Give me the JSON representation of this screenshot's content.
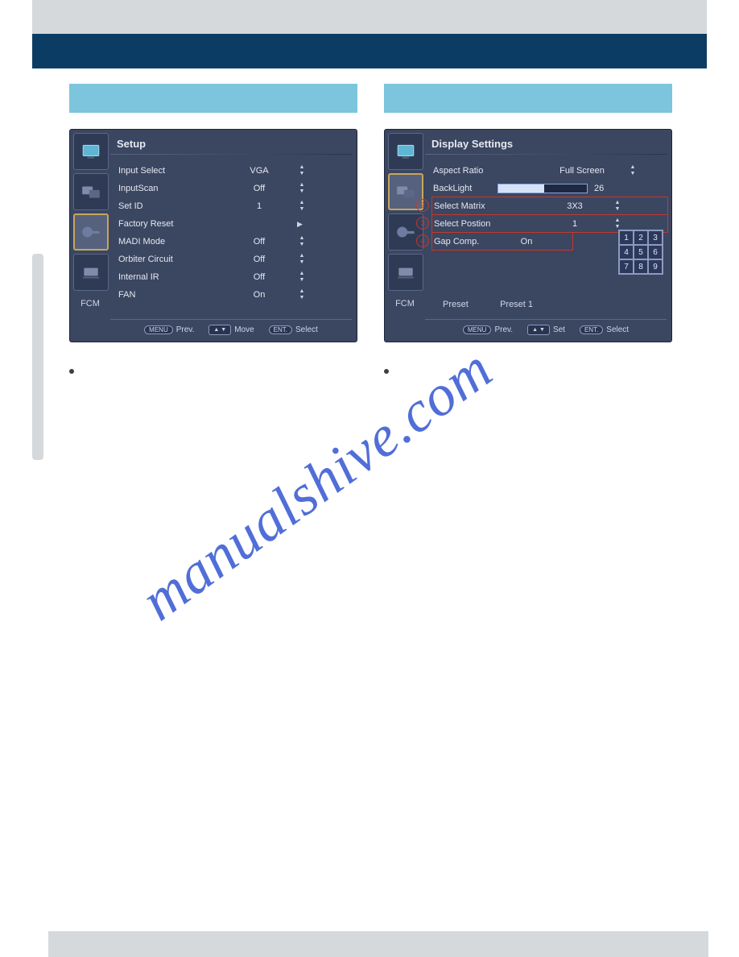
{
  "left": {
    "panelTitle": "Setup",
    "items": [
      {
        "label": "Input Select",
        "value": "VGA",
        "ctrl": "updown"
      },
      {
        "label": "InputScan",
        "value": "Off",
        "ctrl": "updown"
      },
      {
        "label": "Set ID",
        "value": "1",
        "ctrl": "updown"
      },
      {
        "label": "Factory Reset",
        "value": "",
        "ctrl": "enter"
      },
      {
        "label": "MADI Mode",
        "value": "Off",
        "ctrl": "updown"
      },
      {
        "label": "Orbiter Circuit",
        "value": "Off",
        "ctrl": "updown"
      },
      {
        "label": "Internal IR",
        "value": "Off",
        "ctrl": "updown"
      },
      {
        "label": "FAN",
        "value": "On",
        "ctrl": "updown"
      }
    ],
    "fcm": "FCM",
    "hints": {
      "menu_btn": "MENU",
      "menu_lbl": "Prev.",
      "move_lbl": "Move",
      "ent_btn": "ENT.",
      "ent_lbl": "Select"
    }
  },
  "right": {
    "panelTitle": "Display Settings",
    "aspect": {
      "label": "Aspect Ratio",
      "value": "Full Screen"
    },
    "backlight": {
      "label": "BackLight",
      "value": "26"
    },
    "matrix": {
      "num": "2",
      "label": "Select Matrix",
      "value": "3X3"
    },
    "position": {
      "num": "3",
      "label": "Select Postion",
      "value": "1"
    },
    "gap": {
      "num": "4",
      "label": "Gap Comp.",
      "value": "On"
    },
    "grid": [
      "1",
      "2",
      "3",
      "4",
      "5",
      "6",
      "7",
      "8",
      "9"
    ],
    "preset": {
      "label": "Preset",
      "value": "Preset 1"
    },
    "fcm": "FCM",
    "hints": {
      "menu_btn": "MENU",
      "menu_lbl": "Prev.",
      "set_lbl": "Set",
      "ent_btn": "ENT.",
      "ent_lbl": "Select"
    }
  },
  "watermark": "manualshive.com"
}
